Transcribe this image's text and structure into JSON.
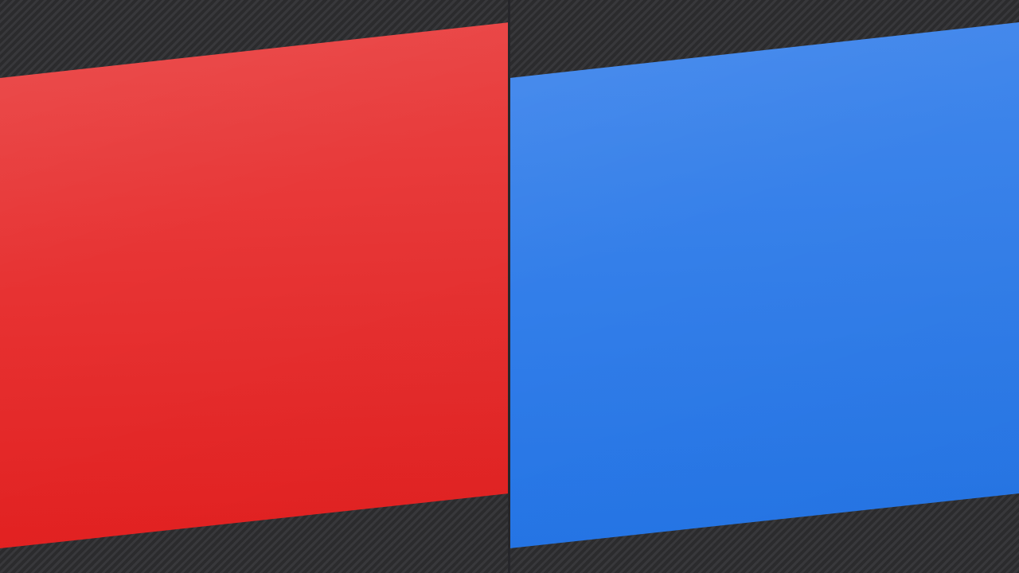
{
  "panels": [
    {
      "id": "left",
      "color_top": "#ea4747",
      "color_bottom": "#e51f1f"
    },
    {
      "id": "right",
      "color_top": "#4388ec",
      "color_bottom": "#2375e8"
    }
  ],
  "background": {
    "base": "#2b2b2d",
    "stripe": "#38383b"
  }
}
